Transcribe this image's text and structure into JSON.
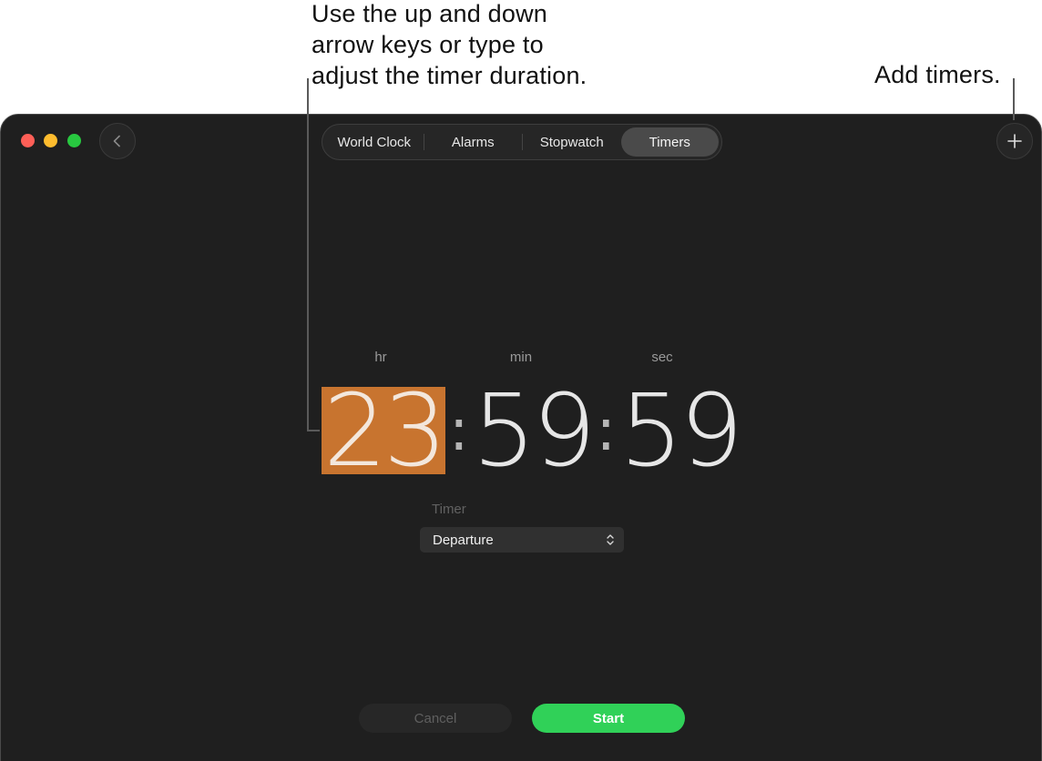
{
  "callouts": {
    "duration_line1": "Use the up and down",
    "duration_line2": "arrow keys or type to",
    "duration_line3": "adjust the timer duration.",
    "add_timers": "Add timers."
  },
  "window": {
    "traffic_lights": {
      "close": "#fe5f57",
      "minimize": "#febc2e",
      "zoom": "#28c840"
    },
    "back_icon": "chevron-left-icon",
    "add_icon": "plus-icon"
  },
  "tabs": [
    {
      "label": "World Clock",
      "active": false
    },
    {
      "label": "Alarms",
      "active": false
    },
    {
      "label": "Stopwatch",
      "active": false
    },
    {
      "label": "Timers",
      "active": true
    }
  ],
  "timer": {
    "hr_label": "hr",
    "min_label": "min",
    "sec_label": "sec",
    "hours": "23",
    "minutes": "59",
    "seconds": "59",
    "separator": ":",
    "selected_field": "hours",
    "selected_color": "#c8742f"
  },
  "sound": {
    "label": "Timer",
    "selected_value": "Departure"
  },
  "actions": {
    "cancel_label": "Cancel",
    "start_label": "Start",
    "start_color": "#30d158"
  }
}
